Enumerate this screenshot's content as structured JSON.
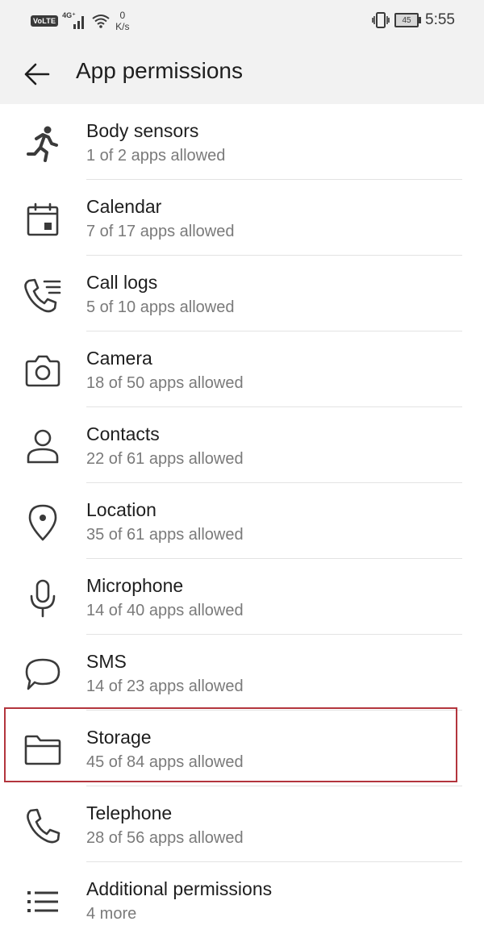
{
  "status_bar": {
    "volte": "VoLTE",
    "network": "4G⁺",
    "speed_value": "0",
    "speed_unit": "K/s",
    "battery": "45",
    "time": "5:55"
  },
  "header": {
    "title": "App permissions"
  },
  "permissions": [
    {
      "icon": "body-sensors-icon",
      "name": "Body sensors",
      "status": "1 of 2 apps allowed"
    },
    {
      "icon": "calendar-icon",
      "name": "Calendar",
      "status": "7 of 17 apps allowed"
    },
    {
      "icon": "call-logs-icon",
      "name": "Call logs",
      "status": "5 of 10 apps allowed"
    },
    {
      "icon": "camera-icon",
      "name": "Camera",
      "status": "18 of 50 apps allowed"
    },
    {
      "icon": "contacts-icon",
      "name": "Contacts",
      "status": "22 of 61 apps allowed"
    },
    {
      "icon": "location-icon",
      "name": "Location",
      "status": "35 of 61 apps allowed"
    },
    {
      "icon": "microphone-icon",
      "name": "Microphone",
      "status": "14 of 40 apps allowed"
    },
    {
      "icon": "sms-icon",
      "name": "SMS",
      "status": "14 of 23 apps allowed"
    },
    {
      "icon": "storage-icon",
      "name": "Storage",
      "status": "45 of 84 apps allowed"
    },
    {
      "icon": "telephone-icon",
      "name": "Telephone",
      "status": "28 of 56 apps allowed"
    },
    {
      "icon": "additional-permissions-icon",
      "name": "Additional permissions",
      "status": "4 more"
    }
  ],
  "highlight_color": "#b3353d"
}
